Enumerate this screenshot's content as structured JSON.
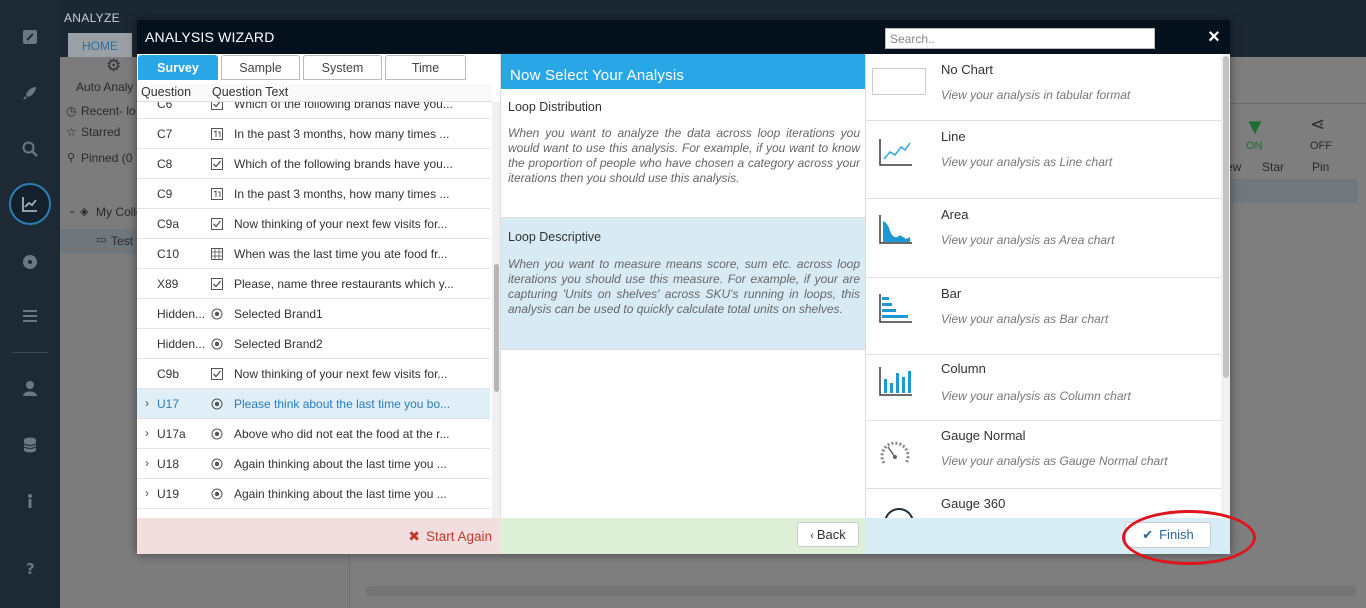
{
  "app": {
    "title": "ANALYZE",
    "home_tab": "HOME",
    "left_panel": {
      "auto_analysis": "Auto Analy",
      "recent": "Recent- lo",
      "starred": "Starred",
      "pinned": "Pinned (0",
      "my_collection": "My Colle",
      "test_item": "Test"
    },
    "toolbar": {
      "filter_state": "ON",
      "share_state": "OFF",
      "view_label": "ew",
      "star_label": "Star",
      "pin_label": "Pin"
    }
  },
  "modal": {
    "title": "ANALYSIS WIZARD",
    "search_placeholder": "Search..",
    "close_label": "×",
    "tabs": [
      "Survey",
      "Sample",
      "System",
      "Time"
    ],
    "active_tab": "Survey",
    "question_list": {
      "col_question": "Question",
      "col_text": "Question Text",
      "rows": [
        {
          "code": "C6",
          "type": "checkbox",
          "text": "Which of the following brands have you...",
          "expandable": false,
          "selected": false
        },
        {
          "code": "C7",
          "type": "number",
          "text": "In the past 3 months, how many times ...",
          "expandable": false,
          "selected": false
        },
        {
          "code": "C8",
          "type": "checkbox",
          "text": "Which of the following brands have you...",
          "expandable": false,
          "selected": false
        },
        {
          "code": "C9",
          "type": "number",
          "text": "In the past 3 months, how many times ...",
          "expandable": false,
          "selected": false
        },
        {
          "code": "C9a",
          "type": "checkbox",
          "text": "Now thinking of your next few visits for...",
          "expandable": false,
          "selected": false
        },
        {
          "code": "C10",
          "type": "grid",
          "text": "When was the last time you ate food fr...",
          "expandable": false,
          "selected": false
        },
        {
          "code": "X89",
          "type": "checkbox",
          "text": "Please, name three restaurants which y...",
          "expandable": false,
          "selected": false
        },
        {
          "code": "Hidden...",
          "type": "radio",
          "text": "Selected Brand1",
          "expandable": false,
          "selected": false
        },
        {
          "code": "Hidden...",
          "type": "radio",
          "text": "Selected Brand2",
          "expandable": false,
          "selected": false
        },
        {
          "code": "C9b",
          "type": "checkbox",
          "text": "Now thinking of your next few visits for...",
          "expandable": false,
          "selected": false
        },
        {
          "code": "U17",
          "type": "radio",
          "text": "Please think about the last time you bo...",
          "expandable": true,
          "selected": true
        },
        {
          "code": "U17a",
          "type": "radio",
          "text": "Above who did not eat the food at the r...",
          "expandable": true,
          "selected": false
        },
        {
          "code": "U18",
          "type": "radio",
          "text": "Again thinking about the last time you ...",
          "expandable": true,
          "selected": false
        },
        {
          "code": "U19",
          "type": "radio",
          "text": "Again thinking about the last time you ...",
          "expandable": true,
          "selected": false
        }
      ]
    },
    "analysis": {
      "heading": "Now Select Your Analysis",
      "options": [
        {
          "title": "Loop Distribution",
          "description": "When you want to analyze the data across loop iterations you would want to use this analysis. For example, if you want to know the proportion of people who have chosen a category across your iterations then you should use this analysis.",
          "selected": false
        },
        {
          "title": "Loop Descriptive",
          "description": "When you want to measure means score, sum etc. across loop iterations you should use this measure. For example, if your are capturing 'Units on shelves' across SKU's running in loops, this analysis can be used to quickly calculate total units on shelves.",
          "selected": true
        }
      ]
    },
    "charts": [
      {
        "name": "No Chart",
        "description": "View your analysis in tabular format",
        "icon": "no-chart-icon"
      },
      {
        "name": "Line",
        "description": "View your analysis as Line chart",
        "icon": "line-chart-icon"
      },
      {
        "name": "Area",
        "description": "View your analysis as Area chart",
        "icon": "area-chart-icon"
      },
      {
        "name": "Bar",
        "description": "View your analysis as Bar chart",
        "icon": "bar-chart-icon"
      },
      {
        "name": "Column",
        "description": "View your analysis as Column chart",
        "icon": "column-chart-icon"
      },
      {
        "name": "Gauge Normal",
        "description": "View your analysis as Gauge Normal chart",
        "icon": "gauge-normal-icon"
      },
      {
        "name": "Gauge 360",
        "description": "",
        "icon": "gauge-360-icon"
      }
    ],
    "footer": {
      "start_again": "Start Again",
      "back": "Back",
      "finish": "Finish"
    },
    "colors": {
      "accent": "#29a6e6",
      "header": "#04111d",
      "danger": "#c0392b",
      "annotation": "#e0141e"
    }
  }
}
